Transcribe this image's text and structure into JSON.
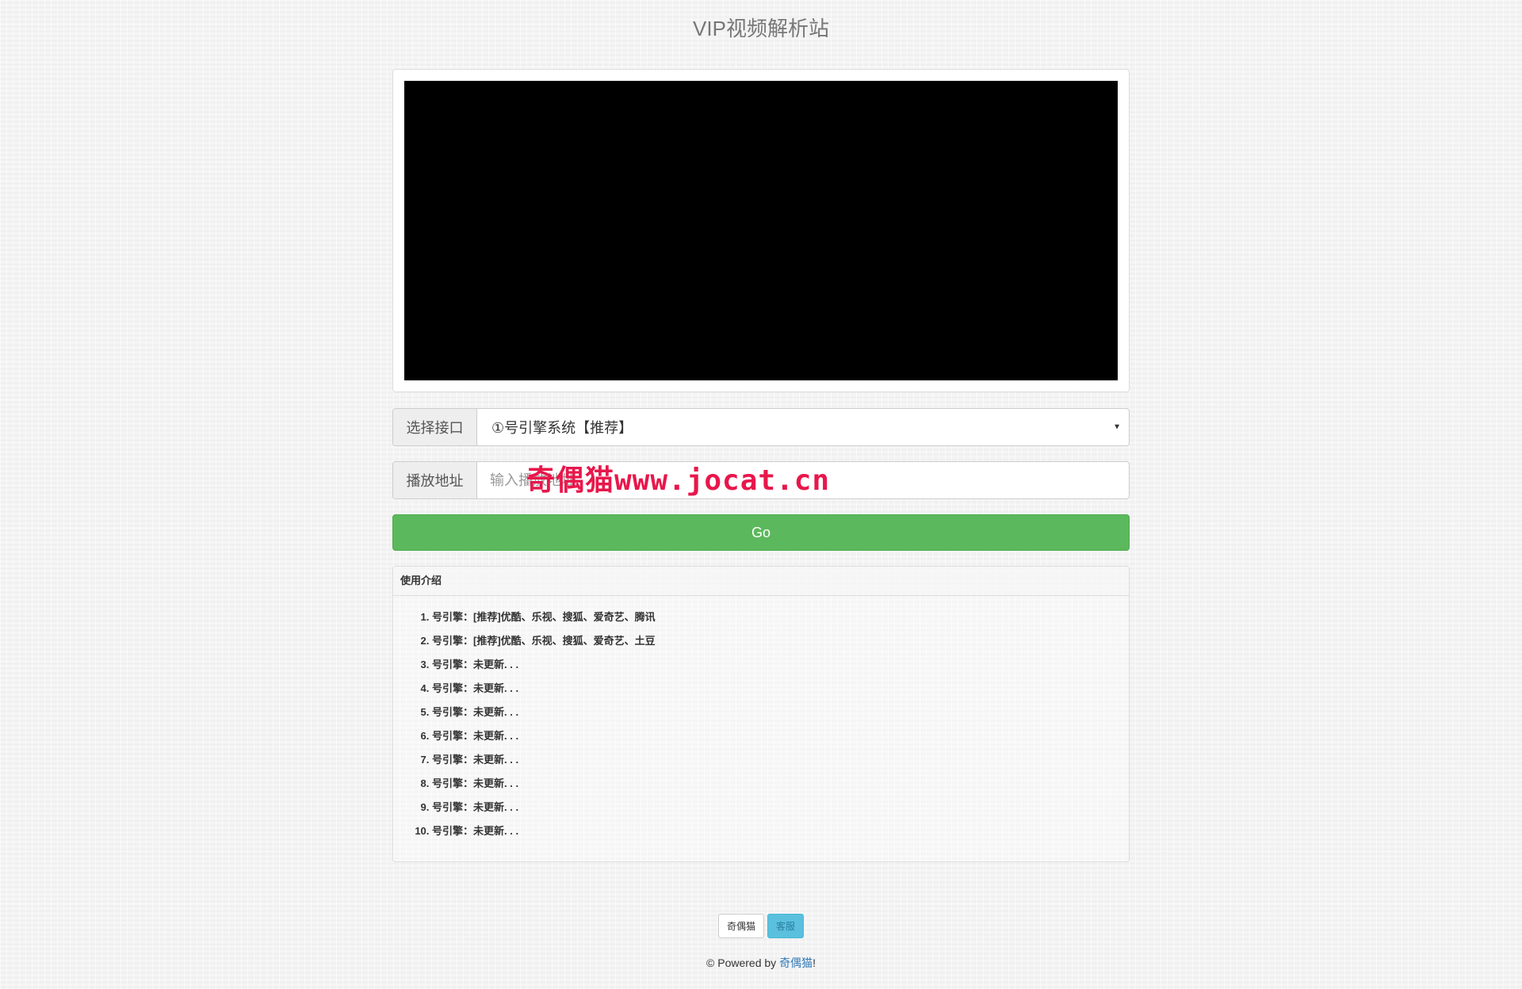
{
  "header": {
    "title": "VIP视频解析站"
  },
  "form": {
    "interface_label": "选择接口",
    "interface_selected": "①号引擎系统【推荐】",
    "url_label": "播放地址",
    "url_placeholder": "输入播放地址",
    "url_value": "",
    "go_label": "Go"
  },
  "watermark": "奇偶猫www.jocat.cn",
  "intro": {
    "heading": "使用介绍",
    "items": [
      "号引擎：[推荐]优酷、乐视、搜狐、爱奇艺、腾讯",
      "号引擎：[推荐]优酷、乐视、搜狐、爱奇艺、土豆",
      "号引擎：未更新. . .",
      "号引擎：未更新. . .",
      "号引擎：未更新. . .",
      "号引擎：未更新. . .",
      "号引擎：未更新. . .",
      "号引擎：未更新. . .",
      "号引擎：未更新. . .",
      "号引擎：未更新. . ."
    ]
  },
  "footer": {
    "button_site": "奇偶猫",
    "button_service": "客服",
    "copyright_prefix": "© Powered by ",
    "copyright_link": "奇偶猫",
    "copyright_suffix": "!"
  },
  "colors": {
    "go_button": "#5cb85c",
    "service_button": "#5bc0de",
    "watermark": "#e8174b",
    "link": "#337ab7"
  }
}
